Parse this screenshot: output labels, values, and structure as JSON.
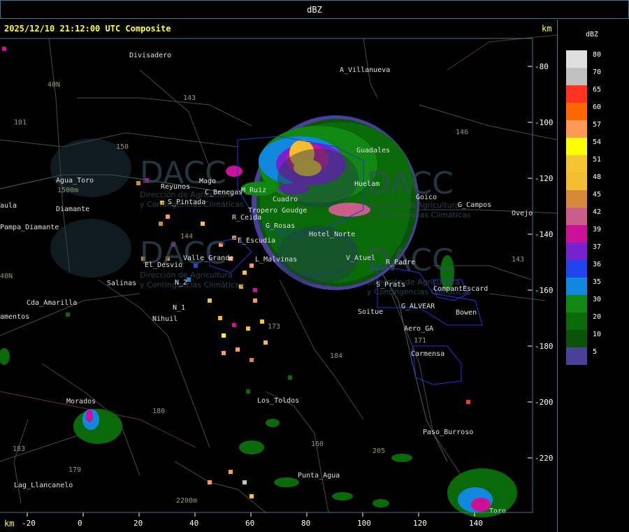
{
  "window": {
    "title": "dBZ"
  },
  "map": {
    "timestamp": "2025/12/10 21:12:00 UTC Composite",
    "km_unit": "km",
    "watermark": {
      "brand": "DACC",
      "text1": "Dirección de Agricultura",
      "text2": "y Contingencias Climáticas"
    },
    "x_ticks": [
      -20,
      0,
      20,
      40,
      60,
      80,
      100,
      120,
      140
    ],
    "y_ticks": [
      -80,
      -100,
      -120,
      -140,
      -160,
      -180,
      -200,
      -220
    ],
    "places": [
      "Divisadero",
      "A_Villanueva",
      "Agua_Toro",
      "1500m",
      "Pampa_Diamante",
      "Diamante",
      "aula",
      "Reyunos",
      "Mago",
      "S_Pintada",
      "C_Benegas",
      "M_Ruiz",
      "Cuadro",
      "Tropero Goudge",
      "R_Ceida",
      "G_Rosas",
      "E_Escudia",
      "Guadales",
      "Huelam",
      "Goico",
      "G_Campos",
      "Ovejo",
      "Hotel_Norte",
      "El_Desvio",
      "Valle_Grande",
      "L_Malvinas",
      "V_Atuel",
      "R_Padre",
      "Salinas",
      "N_2",
      "N_1",
      "Nihuil",
      "Cda_Amarilla",
      "amentos",
      "S_Prats",
      "CompantEscard",
      "G_ALVEAR",
      "Bowen",
      "Soitue",
      "Aero_GA",
      "Carmensa",
      "Los_Toldos",
      "Morados",
      "Paso_Burroso",
      "Lag_Llancanelo",
      "2200m",
      "Punta_Agua",
      "Toro",
      "40N",
      "101",
      "143",
      "150",
      "146",
      "144",
      "173",
      "184",
      "180",
      "183",
      "179",
      "160",
      "205",
      "143",
      "171",
      "40N"
    ],
    "colors": {
      "frame": "#3a7a8c",
      "label": "#ffff33",
      "route_text": "#9a9a6a",
      "roads": "#4a4a4a",
      "province": "#5a3a2a",
      "district": "#2233dd"
    }
  },
  "legend": {
    "title": "dBZ",
    "items": [
      {
        "label": "80",
        "color": "#dedede"
      },
      {
        "label": "70",
        "color": "#c0c0c0"
      },
      {
        "label": "65",
        "color": "#ff3322"
      },
      {
        "label": "60",
        "color": "#ff6600"
      },
      {
        "label": "57",
        "color": "#ff9955"
      },
      {
        "label": "54",
        "color": "#ffff00"
      },
      {
        "label": "51",
        "color": "#f4c431"
      },
      {
        "label": "48",
        "color": "#f4bc31"
      },
      {
        "label": "45",
        "color": "#d58a3a"
      },
      {
        "label": "42",
        "color": "#c95e8a"
      },
      {
        "label": "39",
        "color": "#cc1199"
      },
      {
        "label": "37",
        "color": "#7722cc"
      },
      {
        "label": "36",
        "color": "#2244ee"
      },
      {
        "label": "35",
        "color": "#1188dd"
      },
      {
        "label": "30",
        "color": "#118811"
      },
      {
        "label": "20",
        "color": "#0a6a0a"
      },
      {
        "label": "10",
        "color": "#0b520b"
      },
      {
        "label": "5",
        "color": "#4a3f9a"
      }
    ]
  }
}
